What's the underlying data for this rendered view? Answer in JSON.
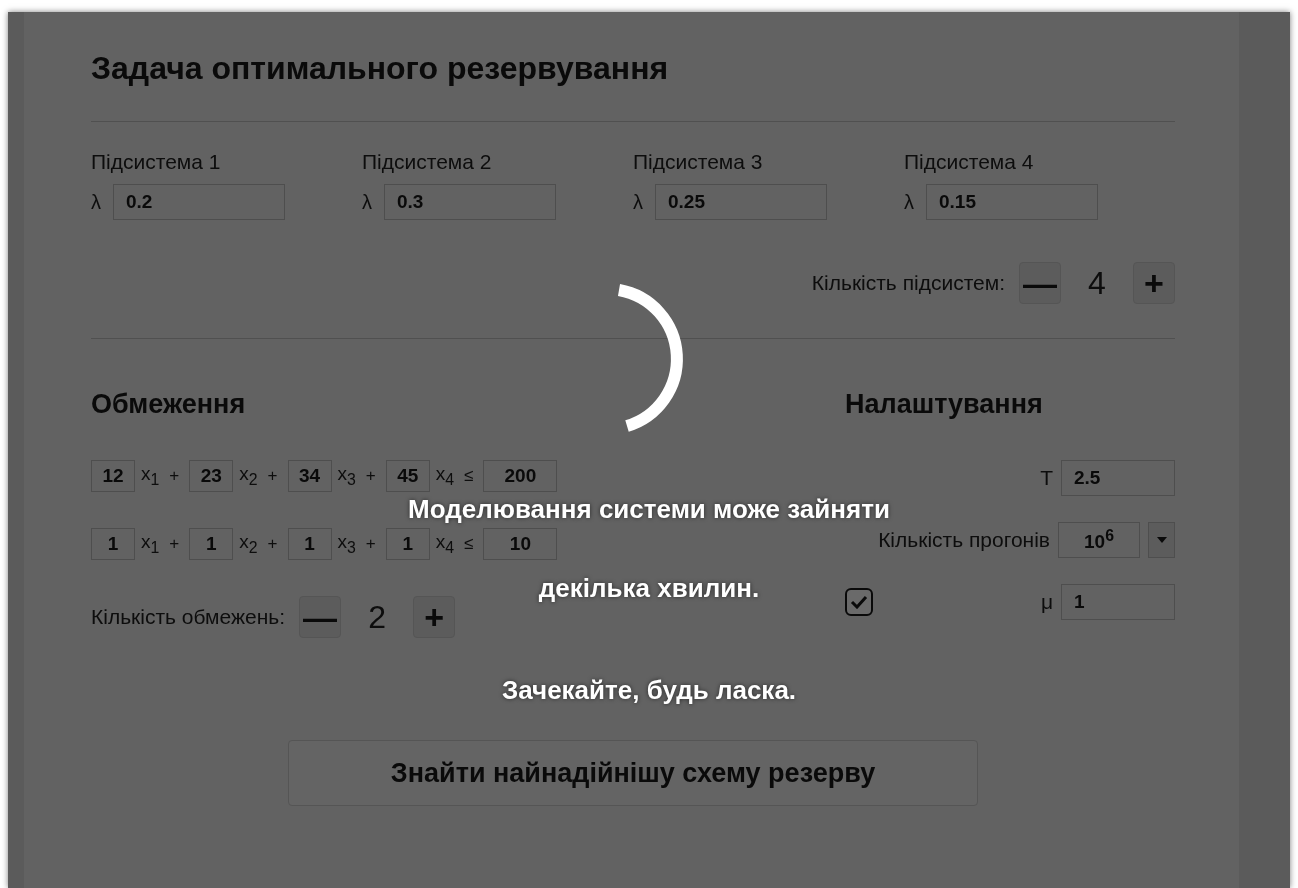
{
  "title": "Задача оптимального резервування",
  "subsystems": [
    {
      "label": "Підсистема 1",
      "symbol": "λ",
      "value": "0.2"
    },
    {
      "label": "Підсистема 2",
      "symbol": "λ",
      "value": "0.3"
    },
    {
      "label": "Підсистема 3",
      "symbol": "λ",
      "value": "0.25"
    },
    {
      "label": "Підсистема 4",
      "symbol": "λ",
      "value": "0.15"
    }
  ],
  "subsystem_count": {
    "label": "Кількість підсистем:",
    "minus": "—",
    "value": "4",
    "plus": "+"
  },
  "constraints": {
    "title": "Обмеження",
    "rows": [
      {
        "terms": [
          {
            "coef": "12",
            "var": "x$_{1}$",
            "op": "+"
          },
          {
            "coef": "23",
            "var": "x$_{2}$",
            "op": "+"
          },
          {
            "coef": "34",
            "var": "x$_{3}$",
            "op": "+"
          },
          {
            "coef": "45",
            "var": "x$_{4}$",
            "op": "≤"
          }
        ],
        "bound": "200"
      },
      {
        "terms": [
          {
            "coef": "1",
            "var": "x$_{1}$",
            "op": "+"
          },
          {
            "coef": "1",
            "var": "x$_{2}$",
            "op": "+"
          },
          {
            "coef": "1",
            "var": "x$_{3}$",
            "op": "+"
          },
          {
            "coef": "1",
            "var": "x$_{4}$",
            "op": "≤"
          }
        ],
        "bound": "10"
      }
    ],
    "count": {
      "label": "Кількість обмежень:",
      "minus": "—",
      "value": "2",
      "plus": "+"
    }
  },
  "settings": {
    "title": "Налаштування",
    "t": {
      "label": "T",
      "value": "2.5"
    },
    "runs": {
      "label": "Кількість прогонів",
      "value": "10$^{6}$"
    },
    "option": {
      "checked": true
    },
    "mu": {
      "label": "μ",
      "value": "1"
    }
  },
  "submit": "Знайти найнадійнішу схему резерву",
  "overlay": {
    "loading": true,
    "lines": [
      "Моделювання системи може зайняти",
      "декілька хвилин.",
      "Зачекайте, будь ласка."
    ]
  }
}
